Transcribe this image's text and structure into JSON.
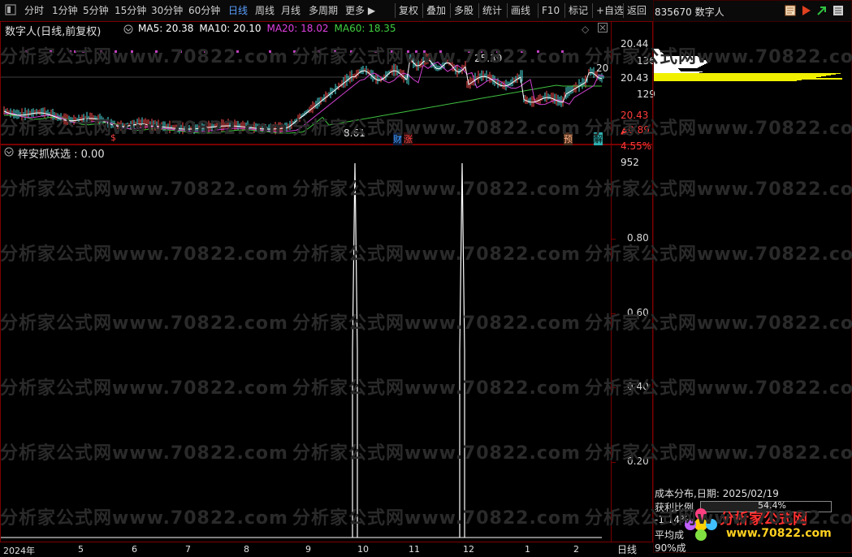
{
  "toolbar": {
    "items": [
      "分时",
      "1分钟",
      "5分钟",
      "15分钟",
      "30分钟",
      "60分钟",
      "日线",
      "周线",
      "月线",
      "多周期",
      "更多"
    ],
    "right_items": [
      "复权",
      "叠加",
      "多股",
      "统计",
      "画线",
      "F10",
      "标记",
      "+自选",
      "返回"
    ]
  },
  "stock": {
    "code_name": "835670 数字人"
  },
  "main_chart": {
    "title": "数字人(日线,前复权)",
    "ma_labels": [
      {
        "text": "MA5: 20.38",
        "color": "#ffffff"
      },
      {
        "text": "MA10: 20.10",
        "color": "#ffffff"
      },
      {
        "text": "MA20: 18.02",
        "color": "#e040e0"
      },
      {
        "text": "MA60: 18.35",
        "color": "#40d040"
      }
    ],
    "high_label": "25.39",
    "low_label": "8.61",
    "right_marker": "20",
    "event_labels": [
      {
        "text": "$",
        "color": "#ff4040"
      },
      {
        "text": "财",
        "color": "#40a0ff"
      },
      {
        "text": "涨",
        "color": "#ff4040"
      },
      {
        "text": "预",
        "color": "#ff8040"
      },
      {
        "text": "解",
        "color": "#40e0e0"
      }
    ]
  },
  "right_axis_top": {
    "values": [
      "20.44",
      "136",
      "20.43",
      "129",
      "20.43",
      "▲0.89",
      "4.55%",
      "952"
    ]
  },
  "indicator": {
    "title": "梓安抓妖选 : 0.00",
    "y_ticks": [
      "0.80",
      "0.60",
      "0.40",
      "0.20"
    ]
  },
  "x_axis": {
    "labels": [
      "2024年",
      "5",
      "6",
      "7",
      "8",
      "9",
      "10",
      "11",
      "12",
      "1",
      "2"
    ],
    "period_tag": "日线"
  },
  "cost_distribution": {
    "title": "成本分布,日期:",
    "date": "2025/02/19",
    "profit_label": "获利比例",
    "profit_value": "54.4%",
    "line2": "-1.14%",
    "line3": "平均成",
    "line4": "90%成"
  },
  "watermark": {
    "text": "分析家公式网www.70822.com",
    "logo_text": "分析家公式网",
    "logo_url": "www.70822.com"
  }
}
